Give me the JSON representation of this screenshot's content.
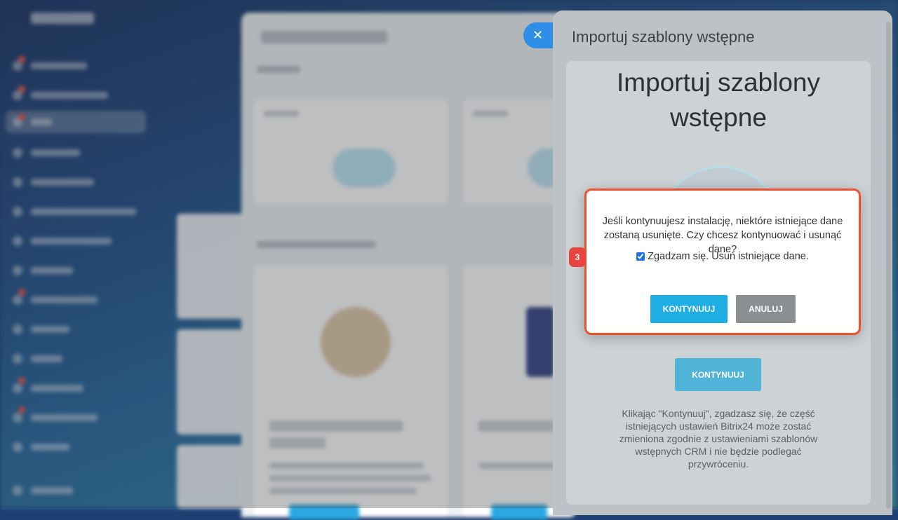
{
  "slider": {
    "header_title": "Importuj szablony wstępne",
    "heading": "Importuj szablony wstępne",
    "continue_label": "KONTYNUUJ",
    "note": "Klikając \"Kontynuuj\", zgadzasz się, że część istniejących ustawień Bitrix24 może zostać zmieniona zgodnie z ustawieniami szablonów wstępnych CRM i nie będzie podlegać przywróceniu."
  },
  "dialog": {
    "message": "Jeśli kontynuujesz instalację, niektóre istniejące dane zostaną usunięte. Czy chcesz kontynuować i usunąć dane?",
    "checkbox_label": "Zgadzam się. Usuń istniejące dane.",
    "checkbox_checked": true,
    "confirm_label": "KONTYNUUJ",
    "cancel_label": "ANULUJ"
  },
  "annotation": {
    "step_number": "3",
    "highlight_color": "#e8532e"
  },
  "icons": {
    "close": "close-icon"
  },
  "colors": {
    "accent_blue": "#1eaee4",
    "cancel_gray": "#8a8f94"
  }
}
